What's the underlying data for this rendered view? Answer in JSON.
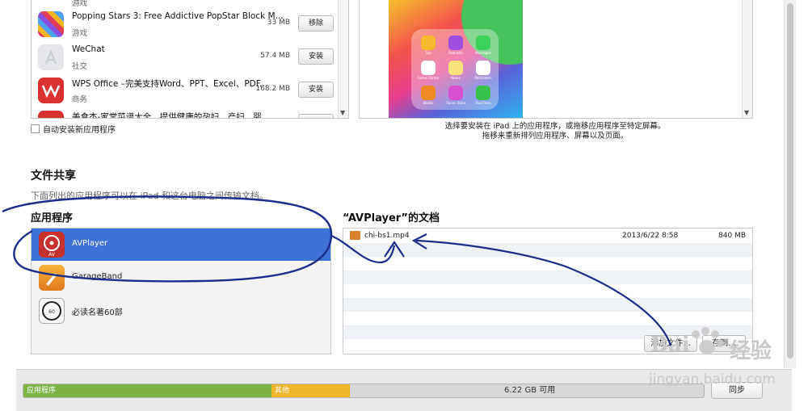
{
  "apps": {
    "partial_top_category": "游戏",
    "rows": [
      {
        "name": "Popping Stars 3: Free Addictive PopStar Block M...",
        "category": "游戏",
        "size": "33 MB",
        "button": "移除"
      },
      {
        "name": "WeChat",
        "category": "社交",
        "size": "57.4 MB",
        "button": "安装"
      },
      {
        "name": "WPS Office –完美支持Word、PPT、Excel、PDF...",
        "category": "商务",
        "size": "168.2 MB",
        "button": "安装"
      },
      {
        "name": "美食杰-家常菜谱大全，提供健康的孕妇、产妇、婴...",
        "category": "",
        "size": "",
        "button": ""
      }
    ],
    "auto_install_label": "自动安装新应用程序"
  },
  "preview": {
    "caption_line1": "选择要安装在 iPad 上的应用程序，或拖移应用程序至特定屏幕。",
    "caption_line2": "拖移来重新排列应用程序、屏幕以及页面。",
    "folder_icons": [
      {
        "label": "Tips",
        "color": "#f5b92b"
      },
      {
        "label": "Podcasts",
        "color": "#a14ee0"
      },
      {
        "label": "Messages",
        "color": "#3fd25a"
      },
      {
        "label": "Game Center",
        "color": "#ffffff"
      },
      {
        "label": "Notes",
        "color": "#f9e27a"
      },
      {
        "label": "Reminders",
        "color": "#ffffff"
      },
      {
        "label": "iBooks",
        "color": "#f08a24"
      },
      {
        "label": "iTunes Store",
        "color": "#d84fd1"
      },
      {
        "label": "FaceTime",
        "color": "#36c24a"
      }
    ]
  },
  "file_sharing": {
    "title": "文件共享",
    "description": "下面列出的应用程序可以在 iPad 和这台电脑之间传输文档。",
    "apps_header": "应用程序",
    "apps": [
      {
        "name": "AVPlayer",
        "selected": true
      },
      {
        "name": "GarageBand",
        "selected": false
      },
      {
        "name": "必读名著60部",
        "selected": false
      }
    ],
    "docs_header": "“AVPlayer”的文档",
    "documents": [
      {
        "name": "chi-bs1.mp4",
        "date": "2013/6/22 8:58",
        "size": "840 MB"
      }
    ],
    "add_button": "添加文件...",
    "save_button": "存到..."
  },
  "capacity": {
    "segments": [
      {
        "label": "应用程序",
        "color": "#7cb342",
        "fraction": 0.365
      },
      {
        "label": "其他",
        "color": "#f0b429",
        "fraction": 0.115
      }
    ],
    "free_text": "6.22 GB 可用",
    "sync_button": "同步"
  },
  "watermark": {
    "brand": "Bai",
    "brand2": "经验",
    "url": "jingyan.baidu.com"
  }
}
